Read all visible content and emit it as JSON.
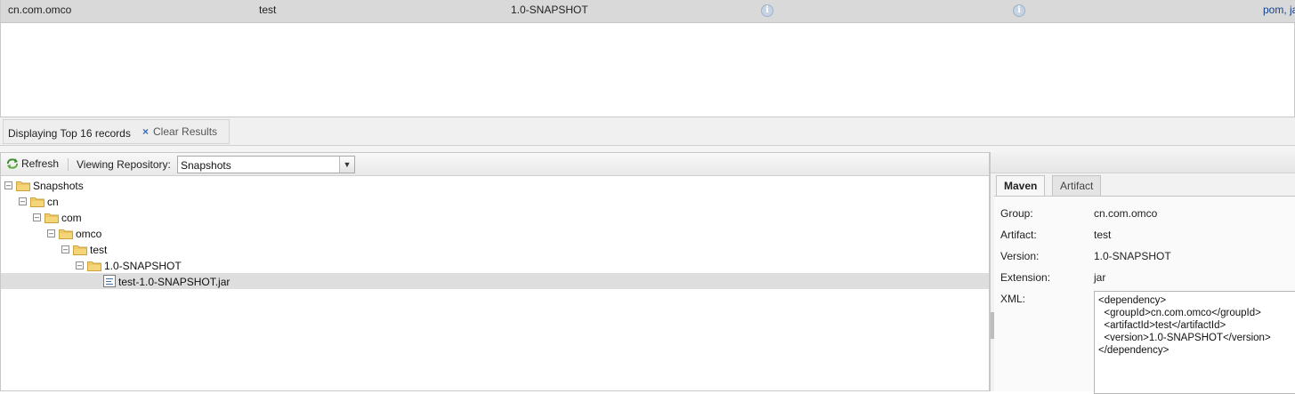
{
  "results": {
    "row": {
      "group": "cn.com.omco",
      "artifact": "test",
      "version": "1.0-SNAPSHOT",
      "info_icon": "info-icon",
      "packaging": "pom, ja"
    }
  },
  "status": {
    "text": "Displaying Top 16 records",
    "clear_label": "Clear Results",
    "clear_icon": "close-icon"
  },
  "toolbar": {
    "refresh_label": "Refresh",
    "refresh_icon": "refresh-icon",
    "repo_label": "Viewing Repository:",
    "repo_selected": "Snapshots"
  },
  "tree": {
    "nodes": [
      {
        "label": "Snapshots",
        "icon": "folder-icon"
      },
      {
        "label": "cn",
        "icon": "folder-icon"
      },
      {
        "label": "com",
        "icon": "folder-icon"
      },
      {
        "label": "omco",
        "icon": "folder-icon"
      },
      {
        "label": "test",
        "icon": "folder-icon"
      },
      {
        "label": "1.0-SNAPSHOT",
        "icon": "folder-icon"
      },
      {
        "label": "test-1.0-SNAPSHOT.jar",
        "icon": "file-icon",
        "selected": true
      }
    ]
  },
  "detail": {
    "tabs": [
      {
        "label": "Maven",
        "active": true
      },
      {
        "label": "Artifact",
        "active": false
      }
    ],
    "fields": {
      "group_label": "Group:",
      "group_value": "cn.com.omco",
      "artifact_label": "Artifact:",
      "artifact_value": "test",
      "version_label": "Version:",
      "version_value": "1.0-SNAPSHOT",
      "extension_label": "Extension:",
      "extension_value": "jar",
      "xml_label": "XML:",
      "xml_value": "<dependency>\n  <groupId>cn.com.omco</groupId>\n  <artifactId>test</artifactId>\n  <version>1.0-SNAPSHOT</version>\n</dependency>"
    }
  },
  "colors": {
    "selected_row": "#dedede",
    "result_row": "#d9d9d9",
    "folder": "#f5d57a",
    "link": "#15428b"
  }
}
